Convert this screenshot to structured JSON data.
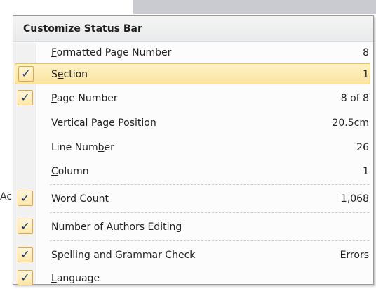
{
  "background": {
    "left_text": "Ac"
  },
  "menu": {
    "title": "Customize Status Bar",
    "items": [
      {
        "pre": "",
        "key": "F",
        "post": "ormatted Page Number",
        "value": "8",
        "checked": false
      },
      {
        "pre": "S",
        "key": "e",
        "post": "ction",
        "value": "1",
        "checked": true
      },
      {
        "pre": "",
        "key": "P",
        "post": "age Number",
        "value": "8 of 8",
        "checked": true
      },
      {
        "pre": "",
        "key": "V",
        "post": "ertical Page Position",
        "value": "20.5cm",
        "checked": false
      },
      {
        "pre": "Line Num",
        "key": "b",
        "post": "er",
        "value": "26",
        "checked": false
      },
      {
        "pre": "",
        "key": "C",
        "post": "olumn",
        "value": "1",
        "checked": false
      },
      {
        "pre": "",
        "key": "W",
        "post": "ord Count",
        "value": "1,068",
        "checked": true
      },
      {
        "pre": "Number of ",
        "key": "A",
        "post": "uthors Editing",
        "value": "",
        "checked": true
      },
      {
        "pre": "",
        "key": "S",
        "post": "pelling and Grammar Check",
        "value": "Errors",
        "checked": true
      },
      {
        "pre": "",
        "key": "L",
        "post": "anguage",
        "value": "",
        "checked": true
      }
    ],
    "check_glyph": "✓",
    "colors": {
      "highlight": "#fbe4a0",
      "check_border": "#e3a64a",
      "check_mark": "#1a3c74"
    }
  }
}
